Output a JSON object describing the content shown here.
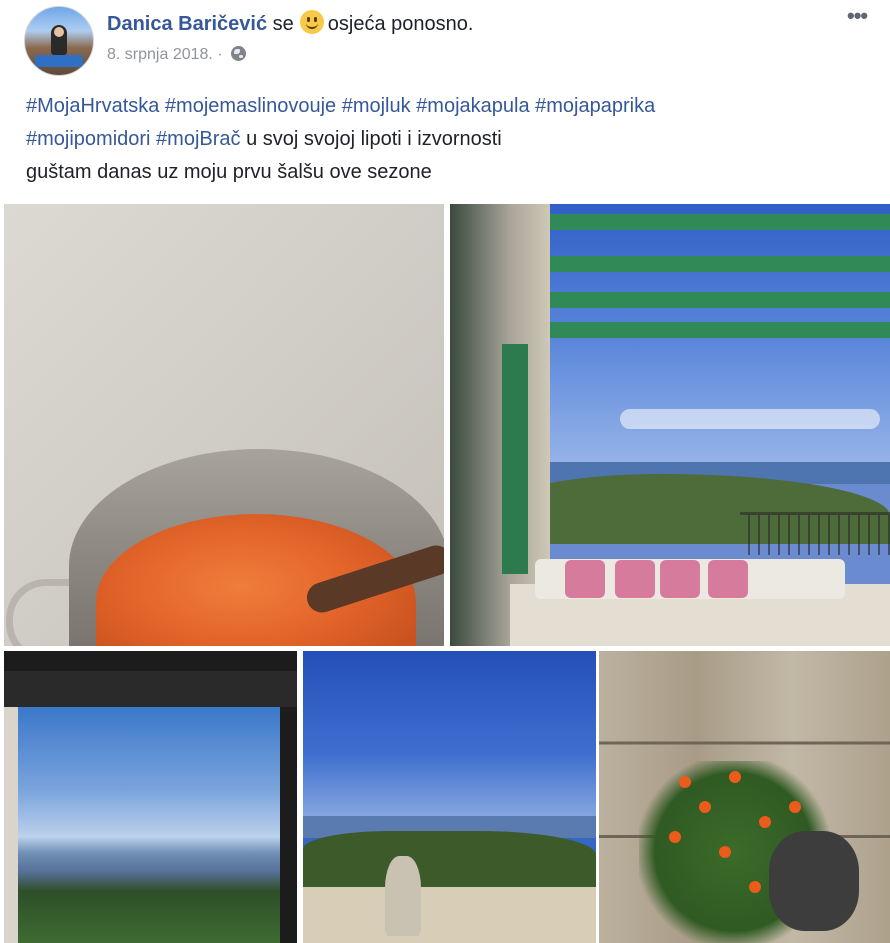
{
  "post": {
    "author": "Danica Baričević",
    "feeling_prefix": "se",
    "feeling_icon": "smiley-icon",
    "feeling_text": "osjeća ponosno.",
    "date": "8. srpnja 2018.",
    "separator": "·",
    "privacy_icon": "globe-icon",
    "more_label": "•••",
    "hashtags_line1": "#MojaHrvatska #mojemaslinovouje #mojluk #mojakapula #mojapaprika",
    "hashtags_line2": "#mojipomidori #mojBrač",
    "text_line2_rest": " u svoj svojoj lipoti i izvornosti",
    "text_line3": "guštam danas uz moju prvu šalšu ove sezone"
  },
  "photos": [
    {
      "subject": "pot of tomato sauce with wooden spoon"
    },
    {
      "subject": "terrace with green pergola and sea view"
    },
    {
      "subject": "view through window over hills and sea"
    },
    {
      "subject": "blue sky with stone and olive trees"
    },
    {
      "subject": "orange flowers in front of stone wall"
    }
  ],
  "colors": {
    "link": "#365899",
    "meta": "#90949c",
    "text": "#1d2129"
  }
}
